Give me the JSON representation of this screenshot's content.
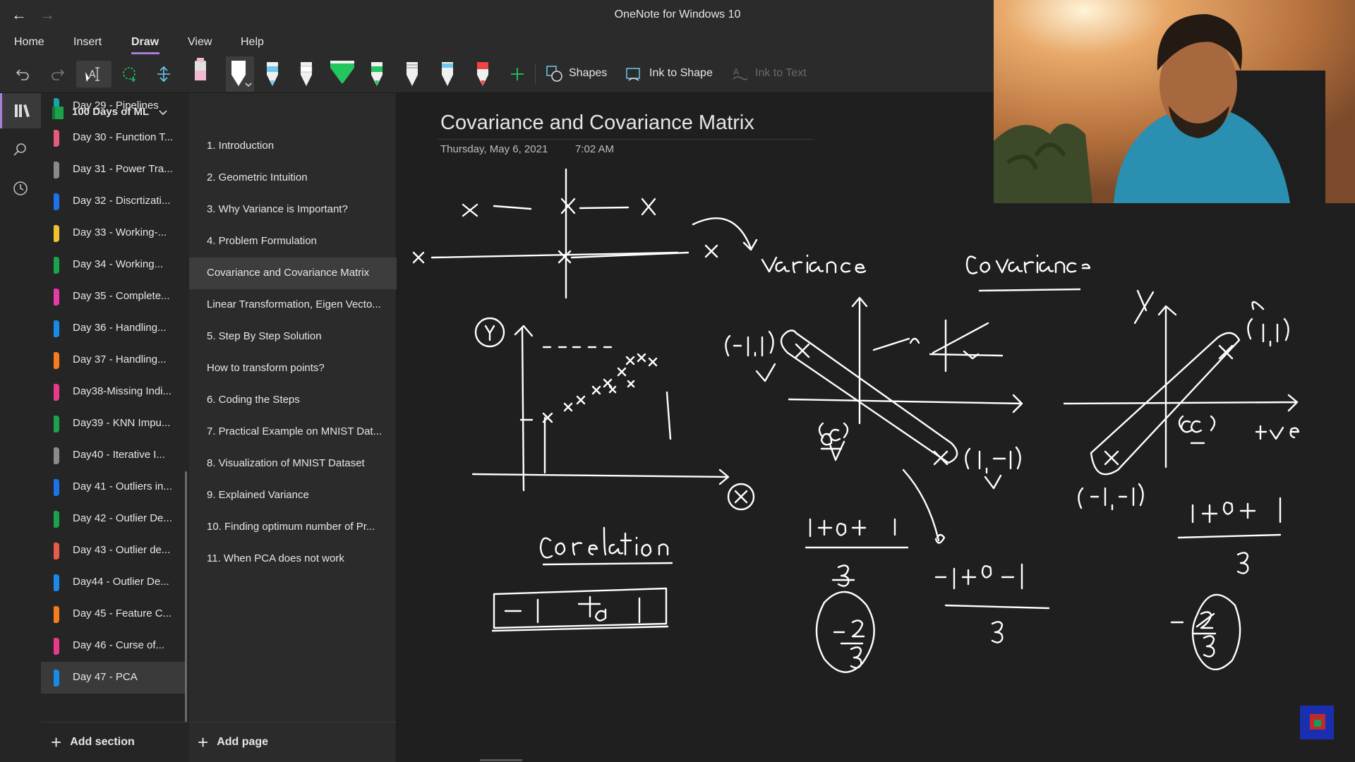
{
  "window": {
    "title": "OneNote for Windows 10"
  },
  "menu": {
    "tabs": [
      {
        "label": "Home"
      },
      {
        "label": "Insert"
      },
      {
        "label": "Draw"
      },
      {
        "label": "View"
      },
      {
        "label": "Help"
      }
    ],
    "active": "Draw"
  },
  "ribbon": {
    "shapes_label": "Shapes",
    "ink_to_shape_label": "Ink to Shape",
    "ink_to_text_label": "Ink to Text",
    "pen_colors": [
      "#f2b8d4",
      "#ffffff",
      "#6cc8f0",
      "#ffffff",
      "#22c55e",
      "#22c55e",
      "#ffffff",
      "#6cc8f0",
      "#ef4444"
    ]
  },
  "notebook": {
    "name": "100 Days of ML"
  },
  "sections": [
    {
      "label": "Day 29 - Pipelines",
      "color": "#1aa3a3"
    },
    {
      "label": "Day 30 - Function T...",
      "color": "#e85a7a"
    },
    {
      "label": "Day 31 - Power Tra...",
      "color": "#8a8a8a"
    },
    {
      "label": "Day 32 - Discrtizati...",
      "color": "#1a73e8"
    },
    {
      "label": "Day 33 - Working-...",
      "color": "#f2c12e"
    },
    {
      "label": "Day 34 - Working...",
      "color": "#1aa34a"
    },
    {
      "label": "Day 35 - Complete...",
      "color": "#e83aa8"
    },
    {
      "label": "Day 36 - Handling...",
      "color": "#1a8ae8"
    },
    {
      "label": "Day 37 - Handling...",
      "color": "#f57c1f"
    },
    {
      "label": "Day38-Missing Indi...",
      "color": "#e83a8a"
    },
    {
      "label": "Day39 - KNN Impu...",
      "color": "#1aa34a"
    },
    {
      "label": "Day40 - Iterative I...",
      "color": "#8a8a8a"
    },
    {
      "label": "Day 41 - Outliers in...",
      "color": "#1a73e8"
    },
    {
      "label": "Day 42 - Outlier De...",
      "color": "#1aa34a"
    },
    {
      "label": "Day 43 - Outlier de...",
      "color": "#e85a4a"
    },
    {
      "label": "Day44 - Outlier De...",
      "color": "#1a8ae8"
    },
    {
      "label": "Day 45 - Feature C...",
      "color": "#f57c1f"
    },
    {
      "label": "Day 46 - Curse of...",
      "color": "#e83a8a"
    },
    {
      "label": "Day 47 - PCA",
      "color": "#1a8ae8"
    }
  ],
  "active_section": "Day 47 - PCA",
  "pages": [
    {
      "label": "1. Introduction"
    },
    {
      "label": "2. Geometric Intuition"
    },
    {
      "label": "3. Why Variance is Important?"
    },
    {
      "label": "4. Problem Formulation"
    },
    {
      "label": "Covariance and Covariance Matrix"
    },
    {
      "label": "Linear Transformation, Eigen Vecto..."
    },
    {
      "label": "5. Step By Step Solution"
    },
    {
      "label": "How to transform points?"
    },
    {
      "label": "6. Coding the Steps"
    },
    {
      "label": "7. Practical Example on MNIST Dat..."
    },
    {
      "label": "8. Visualization of MNIST Dataset"
    },
    {
      "label": "9. Explained Variance"
    },
    {
      "label": "10. Finding optimum number of Pr..."
    },
    {
      "label": "11. When PCA does not work"
    }
  ],
  "active_page": "Covariance and Covariance Matrix",
  "footer": {
    "add_section": "Add section",
    "add_page": "Add page"
  },
  "page": {
    "title": "Covariance and Covariance Matrix",
    "date": "Thursday, May 6, 2021",
    "time": "7:02 AM"
  },
  "handwriting": {
    "variance": "variance",
    "covariance": "Covariance",
    "corelation": "Corelation",
    "range": "−1 to 1",
    "point_pos": "(1,1)",
    "point_neg_left": "(−1,1)",
    "point_neg_right": "(1,−1)",
    "point_neg_neg": "(−1,−1)",
    "origin": "(0,0)",
    "pos_label": "+ve",
    "sum1_num": "1+0+1",
    "sum1_den": "3",
    "sum2_num": "−1+0−1",
    "sum2_den": "3",
    "sum3_num": "1+0+1",
    "sum3_den": "3",
    "frac_left": "−2/3",
    "frac_right": "−2/3",
    "axis_y": "Y",
    "axis_x": "X"
  },
  "colors": {
    "accent": "#a67fd9",
    "ink": "#ffffff"
  }
}
